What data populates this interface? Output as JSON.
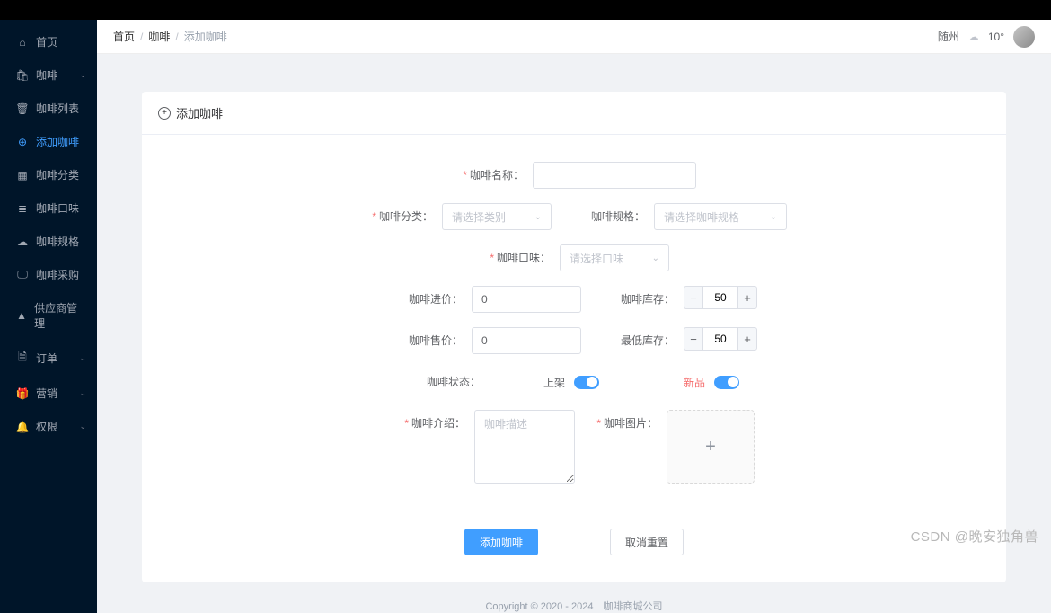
{
  "sidebar": {
    "items": [
      {
        "icon": "⌂",
        "label": "首页"
      },
      {
        "icon": "🛍",
        "label": "咖啡",
        "expand": true
      },
      {
        "icon": "🗑",
        "label": "咖啡列表",
        "sub": true
      },
      {
        "icon": "⊕",
        "label": "添加咖啡",
        "sub": true,
        "active": true
      },
      {
        "icon": "▦",
        "label": "咖啡分类",
        "sub": true
      },
      {
        "icon": "≣",
        "label": "咖啡口味",
        "sub": true
      },
      {
        "icon": "☁",
        "label": "咖啡规格",
        "sub": true
      },
      {
        "icon": "🖵",
        "label": "咖啡采购",
        "sub": true
      },
      {
        "icon": "▲",
        "label": "供应商管理",
        "sub": true
      },
      {
        "icon": "🗎",
        "label": "订单",
        "expand": true
      },
      {
        "icon": "🎁",
        "label": "营销",
        "expand": true
      },
      {
        "icon": "🔔",
        "label": "权限",
        "expand": true
      }
    ]
  },
  "breadcrumb": {
    "home": "首页",
    "parent": "咖啡",
    "current": "添加咖啡"
  },
  "header": {
    "city": "随州",
    "temp": "10°"
  },
  "card": {
    "title": "添加咖啡"
  },
  "form": {
    "name_label": "咖啡名称：",
    "category_label": "咖啡分类：",
    "category_ph": "请选择类别",
    "spec_label": "咖啡规格：",
    "spec_ph": "请选择咖啡规格",
    "taste_label": "咖啡口味：",
    "taste_ph": "请选择口味",
    "cost_label": "咖啡进价：",
    "cost_value": 0,
    "stock_label": "咖啡库存：",
    "stock_value": 50,
    "price_label": "咖啡售价：",
    "price_value": 0,
    "min_stock_label": "最低库存：",
    "min_stock_value": 50,
    "status_label": "咖啡状态：",
    "status_on": "上架",
    "new_label": "新品",
    "desc_label": "咖啡介绍：",
    "desc_ph": "咖啡描述",
    "image_label": "咖啡图片：",
    "submit": "添加咖啡",
    "reset": "取消重置"
  },
  "footer": "Copyright © 2020 - 2024　咖啡商城公司",
  "watermark": "CSDN @晚安独角兽"
}
